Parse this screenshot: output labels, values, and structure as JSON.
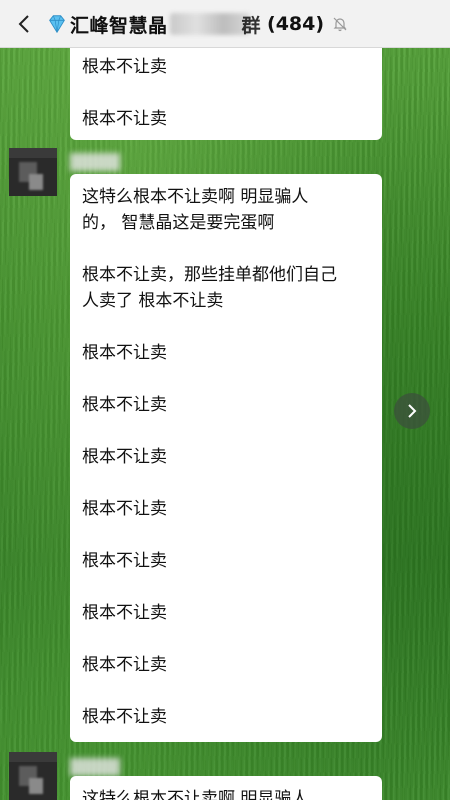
{
  "header": {
    "title_prefix": "汇峰智慧晶",
    "title_suffix_char": "群",
    "member_count": "(484)",
    "icons": [
      "back-icon",
      "diamond-icon",
      "mute-bell-icon"
    ]
  },
  "messages": [
    {
      "id": "msg1",
      "lines": [
        "根本不让卖",
        "根本不让卖"
      ]
    },
    {
      "id": "msg2",
      "paragraphs": [
        [
          "这特么根本不让卖啊  明显骗人",
          "的， 智慧晶这是要完蛋啊"
        ],
        [
          "根本不让卖，那些挂单都他们自己",
          "人卖了 根本不让卖"
        ]
      ],
      "lines": [
        "根本不让卖",
        "根本不让卖",
        "根本不让卖",
        "根本不让卖",
        "根本不让卖",
        "根本不让卖",
        "根本不让卖",
        "根本不让卖"
      ]
    },
    {
      "id": "msg3",
      "lines": [
        "这特么根本不让卖啊  明显骗人"
      ]
    }
  ],
  "colors": {
    "header_bg": "#f2f2f2",
    "bubble_bg": "#ffffff",
    "grass": "#3f8a2c"
  }
}
